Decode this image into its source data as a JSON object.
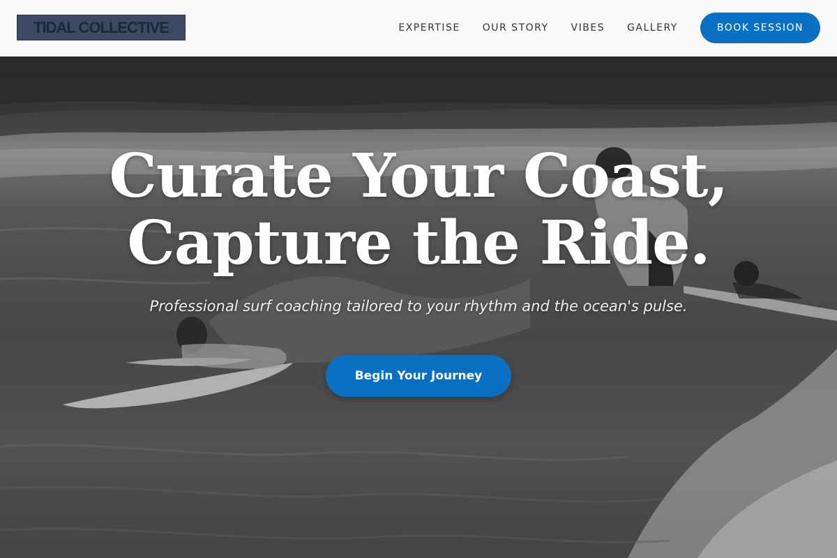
{
  "header": {
    "logo_text": "TIDAL COLLECTIVE",
    "nav": [
      {
        "label": "EXPERTISE"
      },
      {
        "label": "OUR STORY"
      },
      {
        "label": "VIBES"
      },
      {
        "label": "GALLERY"
      }
    ],
    "cta_label": "BOOK SESSION"
  },
  "hero": {
    "title_line1": "Curate Your Coast,",
    "title_line2": "Capture the Ride.",
    "subtitle": "Professional surf coaching tailored to your rhythm and the ocean's pulse.",
    "cta_label": "Begin Your Journey",
    "background_image": "black-and-white surfers paddling through waves"
  },
  "colors": {
    "accent": "#0a70c4",
    "header_bg": "#ffffff",
    "logo_bg": "#3c4a63"
  }
}
